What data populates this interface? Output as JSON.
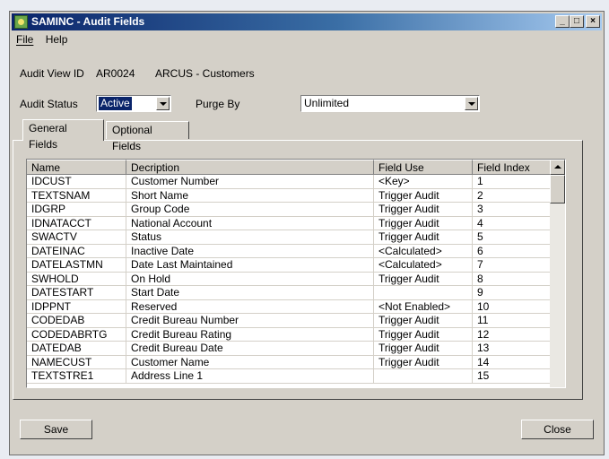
{
  "window": {
    "title": "SAMINC - Audit Fields",
    "app_icon": "sage-app-icon"
  },
  "titlebar_buttons": {
    "minimize": "_",
    "maximize": "□",
    "close": "×"
  },
  "menu": {
    "file": "File",
    "help": "Help"
  },
  "audit_view": {
    "label": "Audit View ID",
    "id": "AR0024",
    "description": "ARCUS - Customers"
  },
  "audit_status": {
    "label": "Audit Status",
    "value": "Active"
  },
  "purge_by": {
    "label": "Purge By",
    "value": "Unlimited"
  },
  "tabs": [
    {
      "label": "General Fields",
      "active": true
    },
    {
      "label": "Optional Fields",
      "active": false
    }
  ],
  "grid": {
    "columns": [
      "Name",
      "Decription",
      "Field Use",
      "Field Index"
    ],
    "rows": [
      [
        "IDCUST",
        "Customer Number",
        "<Key>",
        "1"
      ],
      [
        "TEXTSNAM",
        "Short Name",
        "Trigger Audit",
        "2"
      ],
      [
        "IDGRP",
        "Group Code",
        "Trigger Audit",
        "3"
      ],
      [
        "IDNATACCT",
        "National Account",
        "Trigger Audit",
        "4"
      ],
      [
        "SWACTV",
        "Status",
        "Trigger Audit",
        "5"
      ],
      [
        "DATEINAC",
        "Inactive Date",
        "<Calculated>",
        "6"
      ],
      [
        "DATELASTMN",
        "Date Last Maintained",
        "<Calculated>",
        "7"
      ],
      [
        "SWHOLD",
        "On Hold",
        "Trigger Audit",
        "8"
      ],
      [
        "DATESTART",
        "Start Date",
        "",
        "9"
      ],
      [
        "IDPPNT",
        "Reserved",
        "<Not Enabled>",
        "10"
      ],
      [
        "CODEDAB",
        "Credit Bureau Number",
        "Trigger Audit",
        "11"
      ],
      [
        "CODEDABRTG",
        "Credit Bureau Rating",
        "Trigger Audit",
        "12"
      ],
      [
        "DATEDAB",
        "Credit Bureau Date",
        "Trigger Audit",
        "13"
      ],
      [
        "NAMECUST",
        "Customer Name",
        "Trigger Audit",
        "14"
      ],
      [
        "TEXTSTRE1",
        "Address Line 1",
        "",
        "15"
      ]
    ]
  },
  "buttons": {
    "save": "Save",
    "close": "Close"
  },
  "colors": {
    "title_start": "#0a246a",
    "title_end": "#a6caf0",
    "face": "#d4d0c8",
    "selection": "#0a246a"
  }
}
